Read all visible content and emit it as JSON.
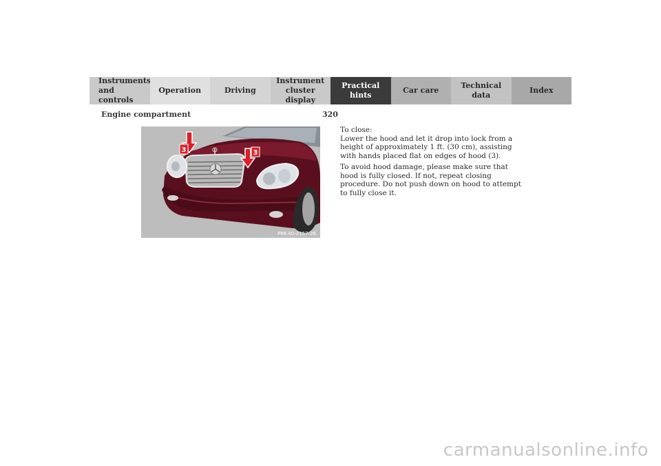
{
  "nav": {
    "tabs": [
      {
        "label": "Instruments\nand controls",
        "bg": "#c9c9c9",
        "active": false
      },
      {
        "label": "Operation",
        "bg": "#e0e0e0",
        "active": false
      },
      {
        "label": "Driving",
        "bg": "#d4d4d4",
        "active": false
      },
      {
        "label": "Instrument\ncluster display",
        "bg": "#c9c9c9",
        "active": false
      },
      {
        "label": "Practical hints",
        "bg": "#3b3b3b",
        "active": true
      },
      {
        "label": "Car care",
        "bg": "#b0b0b0",
        "active": false
      },
      {
        "label": "Technical\ndata",
        "bg": "#c2c2c2",
        "active": false
      },
      {
        "label": "Index",
        "bg": "#a8a8a8",
        "active": false
      }
    ]
  },
  "header": {
    "title": "Engine compartment",
    "page_number": "320"
  },
  "figure": {
    "label_left": "3",
    "label_right": "3",
    "code": "P88.40-2157-26",
    "arrow_color": "#d8202a",
    "car_color": "#5a0f1e"
  },
  "content": {
    "close_heading": "To close:",
    "close_text": "Lower the hood and let it drop into lock from a height of approximately 1 ft. (30 cm), assisting with hands placed flat on edges of hood (3).",
    "damage_text": "To avoid hood damage, please make sure that hood is fully closed. If not, repeat closing procedure. Do not push down on hood to attempt to fully close it."
  },
  "watermark": "carmanualsonline.info"
}
